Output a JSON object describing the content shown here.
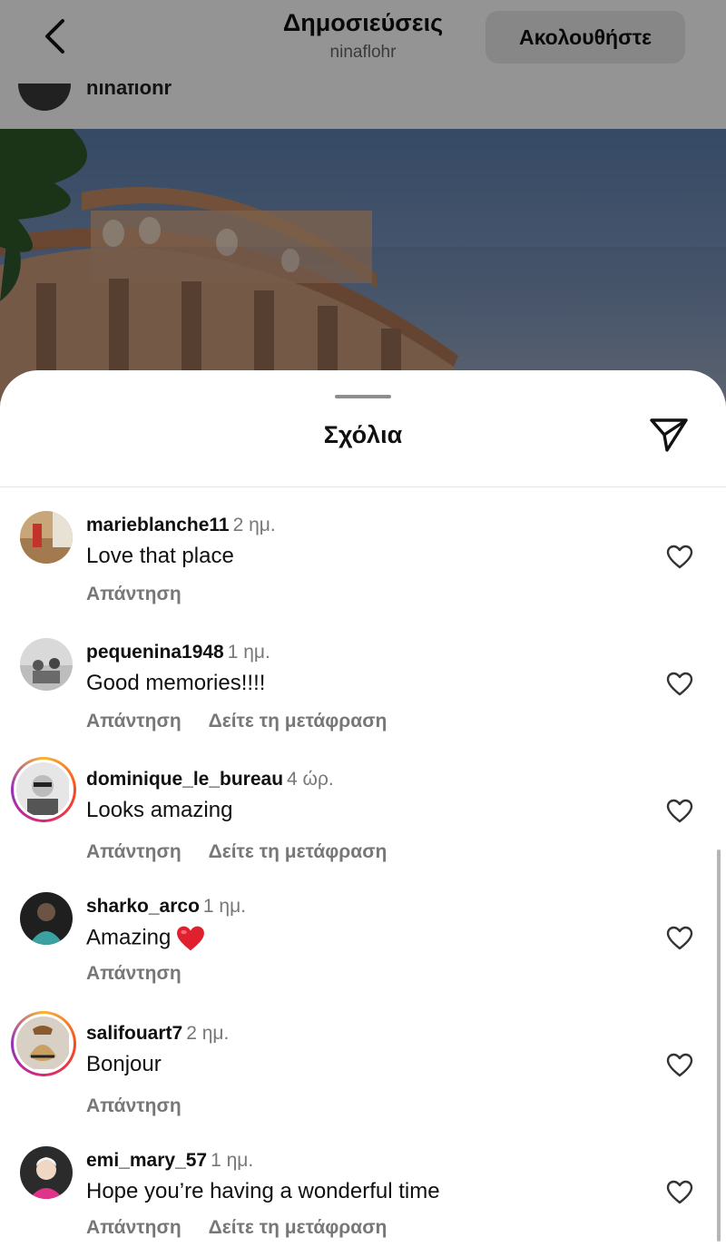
{
  "header": {
    "title": "Δημοσιεύσεις",
    "subtitle": "ninaflohr",
    "follow_label": "Ακολουθήστε",
    "post_username": "ninaflohr"
  },
  "sheet": {
    "title": "Σχόλια"
  },
  "comments": [
    {
      "username": "marieblanche11",
      "time": "2 ημ.",
      "text": "Love that place",
      "reply": "Απάντηση",
      "translate": ""
    },
    {
      "username": "pequenina1948",
      "time": "1 ημ.",
      "text": "Good memories!!!!",
      "reply": "Απάντηση",
      "translate": "Δείτε τη μετάφραση"
    },
    {
      "username": "dominique_le_bureau",
      "time": "4 ώρ.",
      "text": "Looks amazing",
      "reply": "Απάντηση",
      "translate": "Δείτε τη μετάφραση"
    },
    {
      "username": "sharko_arco",
      "time": "1 ημ.",
      "text": "Amazing",
      "reply": "Απάντηση",
      "translate": ""
    },
    {
      "username": "salifouart7",
      "time": "2 ημ.",
      "text": "Bonjour",
      "reply": "Απάντηση",
      "translate": ""
    },
    {
      "username": "emi_mary_57",
      "time": "1 ημ.",
      "text": "Hope you’re having a wonderful time",
      "reply": "Απάντηση",
      "translate": "Δείτε τη μετάφραση"
    }
  ],
  "icons": {
    "back": "chevron-left-icon",
    "share": "paper-plane-icon",
    "like": "heart-outline-icon",
    "emoji": "red-heart-emoji"
  },
  "colors": {
    "accent_ring": "#d62976",
    "muted_text": "#777777",
    "heart_emoji": "#e0202f"
  }
}
